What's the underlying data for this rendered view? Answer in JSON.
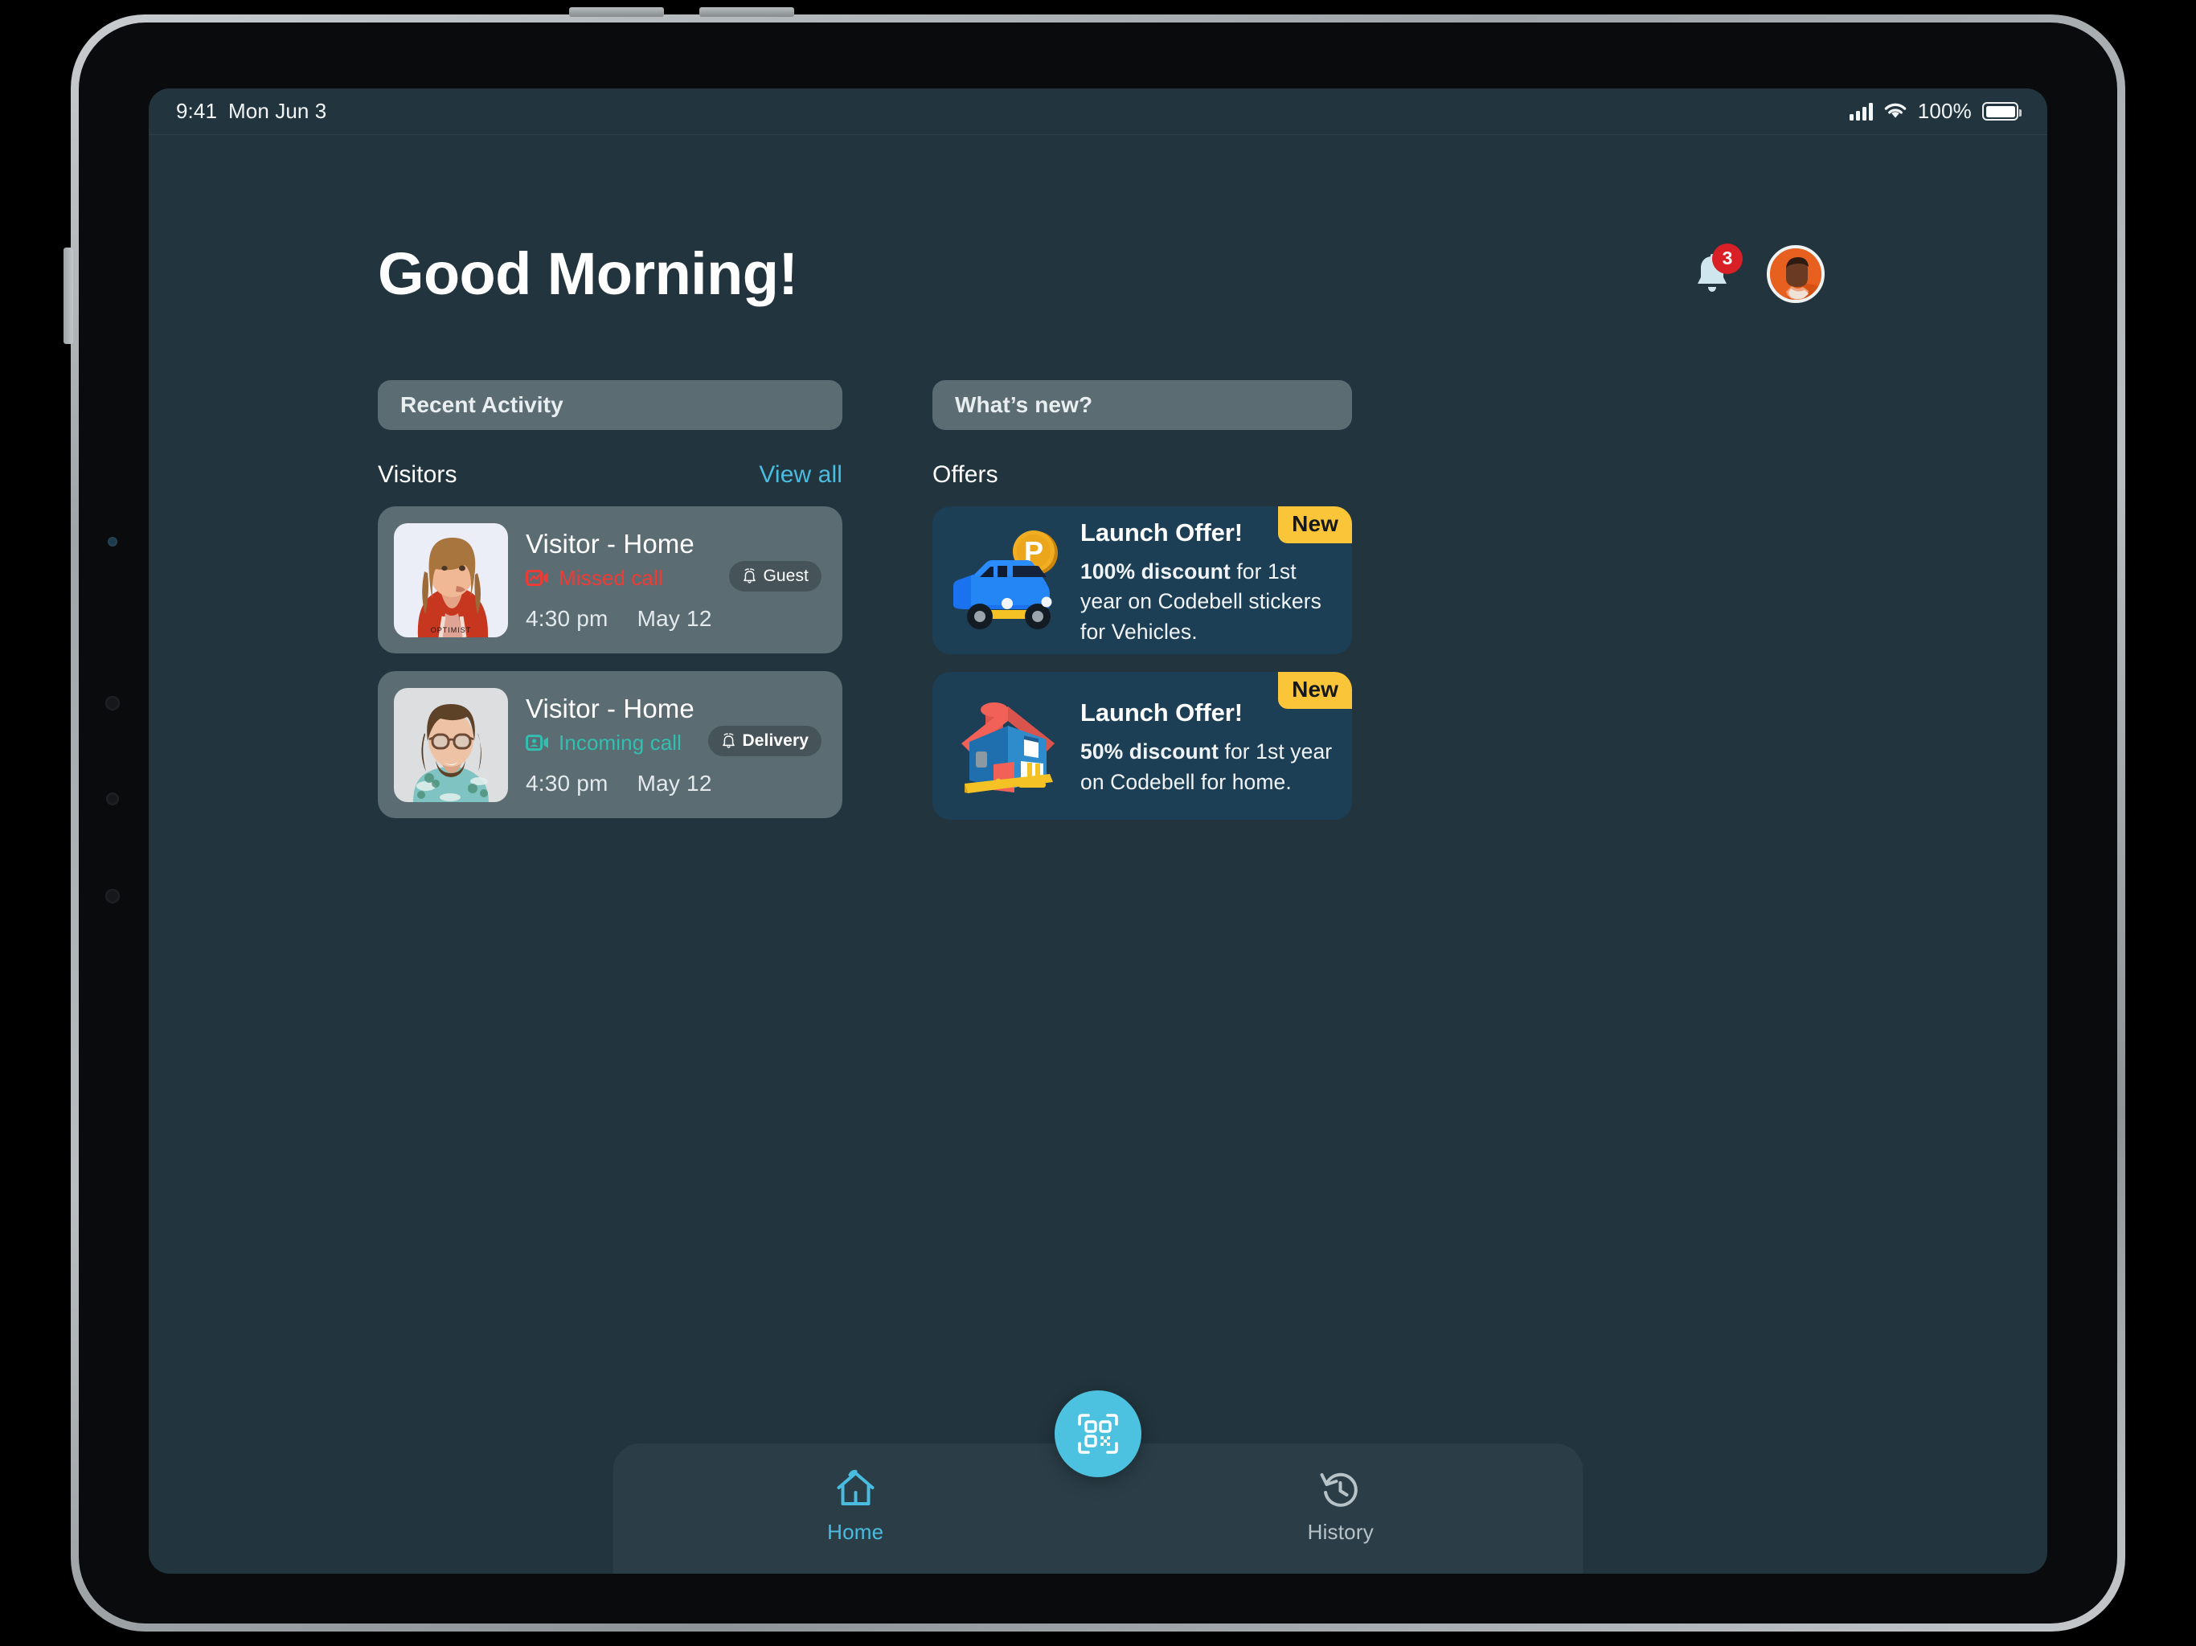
{
  "status_bar": {
    "time": "9:41",
    "date": "Mon Jun 3",
    "battery_percent": "100%",
    "signal_icon": "cellular-bars-icon",
    "wifi_icon": "wifi-icon",
    "battery_icon": "battery-full-icon"
  },
  "header": {
    "title": "Good Morning!",
    "notification_count": "3",
    "bell_icon": "bell-icon",
    "avatar_icon": "user-avatar"
  },
  "left_column": {
    "section_label": "Recent Activity",
    "list_title": "Visitors",
    "view_all_label": "View all",
    "visitors": [
      {
        "name": "Visitor - Home",
        "call_status": "Missed call",
        "call_type": "missed",
        "call_icon": "missed-video-call-icon",
        "tag": "Guest",
        "tag_icon": "doorbell-icon",
        "time": "4:30 pm",
        "date": "May 12",
        "photo_alt": "woman-in-red-hoodie"
      },
      {
        "name": "Visitor - Home",
        "call_status": "Incoming call",
        "call_type": "incoming",
        "call_icon": "incoming-video-call-icon",
        "tag": "Delivery",
        "tag_icon": "doorbell-icon",
        "time": "4:30 pm",
        "date": "May 12",
        "photo_alt": "man-with-glasses-floral-shirt"
      }
    ]
  },
  "right_column": {
    "section_label": "What’s new?",
    "list_title": "Offers",
    "offers": [
      {
        "badge": "New",
        "title": "Launch Offer!",
        "highlight": "100% discount",
        "body_rest": " for 1st year on Codebell stickers for Vehicles.",
        "art": "blue-car-with-parking-sign-illustration"
      },
      {
        "badge": "New",
        "title": "Launch Offer!",
        "highlight": "50% discount",
        "body_rest": " for 1st year on Codebell for home.",
        "art": "blue-house-with-red-roof-illustration"
      }
    ]
  },
  "bottom_nav": {
    "items": [
      {
        "label": "Home",
        "icon": "home-icon",
        "active": true
      },
      {
        "label": "History",
        "icon": "history-clock-icon",
        "active": false
      }
    ],
    "fab_icon": "qr-scan-icon"
  },
  "colors": {
    "app_background": "#22343d",
    "card_background": "#5b6c73",
    "offer_background": "#1d3f56",
    "accent_cyan": "#49bcdf",
    "badge_yellow": "#fbc53a",
    "missed_red": "#ef3b36",
    "incoming_teal": "#33bfb0",
    "notification_red": "#d92027",
    "nav_background": "#2b3e48"
  }
}
